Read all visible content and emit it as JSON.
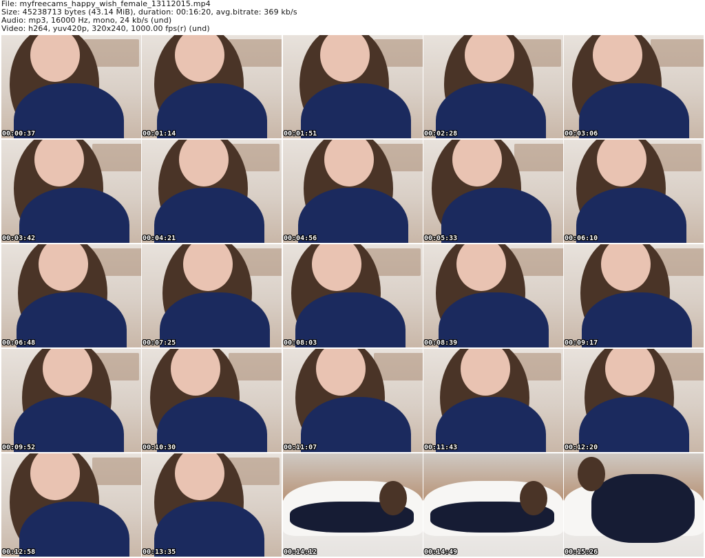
{
  "header": {
    "file_line": "File: myfreecams_happy_wish_female_13112015.mp4",
    "size_line": "Size: 45238713 bytes (43.14 MiB), duration: 00:16:20, avg.bitrate: 369 kb/s",
    "audio_line": "Audio: mp3, 16000 Hz, mono, 24 kb/s (und)",
    "video_line": "Video: h264, yuv420p, 320x240, 1000.00 fps(r) (und)"
  },
  "thumbnails": [
    {
      "timestamp": "00:00:37",
      "scene": "closeup"
    },
    {
      "timestamp": "00:01:14",
      "scene": "closeup"
    },
    {
      "timestamp": "00:01:51",
      "scene": "closeup"
    },
    {
      "timestamp": "00:02:28",
      "scene": "closeup"
    },
    {
      "timestamp": "00:03:06",
      "scene": "closeup"
    },
    {
      "timestamp": "00:03:42",
      "scene": "closeup"
    },
    {
      "timestamp": "00:04:21",
      "scene": "closeup"
    },
    {
      "timestamp": "00:04:56",
      "scene": "closeup"
    },
    {
      "timestamp": "00:05:33",
      "scene": "closeup"
    },
    {
      "timestamp": "00:06:10",
      "scene": "closeup"
    },
    {
      "timestamp": "00:06:48",
      "scene": "closeup"
    },
    {
      "timestamp": "00:07:25",
      "scene": "closeup"
    },
    {
      "timestamp": "00:08:03",
      "scene": "closeup"
    },
    {
      "timestamp": "00:08:39",
      "scene": "closeup"
    },
    {
      "timestamp": "00:09:17",
      "scene": "closeup"
    },
    {
      "timestamp": "00:09:52",
      "scene": "closeup"
    },
    {
      "timestamp": "00:10:30",
      "scene": "closeup"
    },
    {
      "timestamp": "00:11:07",
      "scene": "closeup"
    },
    {
      "timestamp": "00:11:43",
      "scene": "closeup"
    },
    {
      "timestamp": "00:12:20",
      "scene": "closeup"
    },
    {
      "timestamp": "00:12:58",
      "scene": "closeup"
    },
    {
      "timestamp": "00:13:35",
      "scene": "closeup"
    },
    {
      "timestamp": "00:14:12",
      "scene": "lying"
    },
    {
      "timestamp": "00:14:49",
      "scene": "lying"
    },
    {
      "timestamp": "00:15:26",
      "scene": "lying"
    }
  ],
  "colors": {
    "background": "#ffffff",
    "header_text": "#111111",
    "shirt": "#1b2a5e",
    "hair": "#4a3427",
    "skin": "#e9c3b2",
    "wall": "#e8e2dc",
    "floor": "#b9896c",
    "couch": "#f2f0ee",
    "pants": "#161c34",
    "timestamp_text": "#ffffff",
    "timestamp_outline": "#000000"
  }
}
